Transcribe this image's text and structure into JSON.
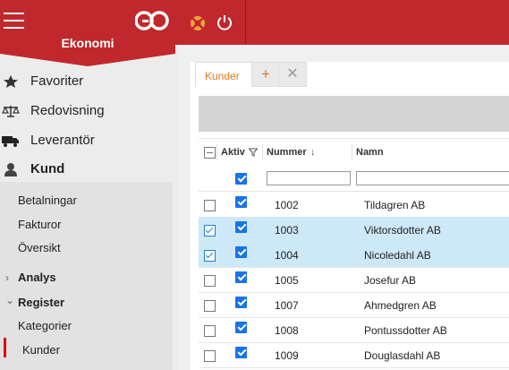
{
  "app": {
    "module": "Ekonomi",
    "logo_text": "GO",
    "colors": {
      "brand": "#c0282d",
      "accent": "#e2761f",
      "selected_row": "#cde8f7",
      "checkbox": "#1a73e8"
    }
  },
  "sidebar": {
    "items": [
      {
        "label": "Favoriter",
        "icon": "star-icon"
      },
      {
        "label": "Redovisning",
        "icon": "scales-icon"
      },
      {
        "label": "Leverantör",
        "icon": "truck-icon"
      },
      {
        "label": "Kund",
        "icon": "user-icon"
      }
    ],
    "kund_sub": [
      "Betalningar",
      "Fakturor",
      "Översikt"
    ],
    "sections": [
      {
        "label": "Analys",
        "chevron": "›"
      },
      {
        "label": "Register",
        "chevron": "⌄"
      }
    ],
    "register_sub": [
      "Kategorier",
      "Kunder"
    ]
  },
  "tabs": {
    "active": "Kunder",
    "add": "+",
    "close": "✕"
  },
  "grid": {
    "columns": [
      "Aktiv",
      "Nummer",
      "Namn"
    ],
    "sort_arrow": "↓",
    "rows": [
      {
        "number": "1002",
        "name": "Tildagren AB",
        "selected": false,
        "active": true
      },
      {
        "number": "1003",
        "name": "Viktorsdotter AB",
        "selected": true,
        "active": true
      },
      {
        "number": "1004",
        "name": "Nicoledahl AB",
        "selected": true,
        "active": true
      },
      {
        "number": "1005",
        "name": "Josefur AB",
        "selected": false,
        "active": true
      },
      {
        "number": "1007",
        "name": "Ahmedgren AB",
        "selected": false,
        "active": true
      },
      {
        "number": "1008",
        "name": "Pontussdotter AB",
        "selected": false,
        "active": true
      },
      {
        "number": "1009",
        "name": "Douglasdahl AB",
        "selected": false,
        "active": true
      }
    ]
  }
}
